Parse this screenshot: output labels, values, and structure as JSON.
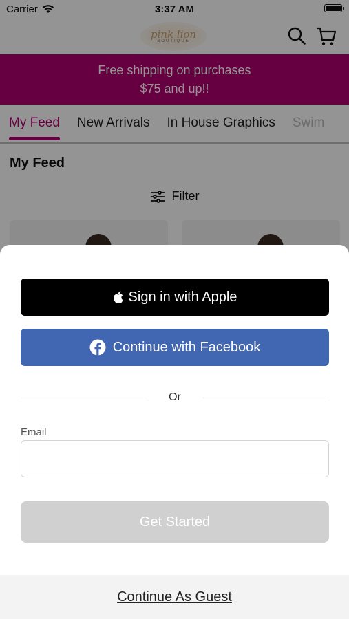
{
  "status_bar": {
    "carrier": "Carrier",
    "time": "3:37 AM"
  },
  "header": {
    "logo_text": "pink lion",
    "logo_subtext": "BOUTIQUE"
  },
  "promo": {
    "line1": "Free shipping on purchases",
    "line2": "$75 and up!!",
    "color": "#b1006e"
  },
  "tabs": [
    {
      "label": "My Feed",
      "active": true
    },
    {
      "label": "New Arrivals",
      "active": false
    },
    {
      "label": "In House Graphics",
      "active": false
    },
    {
      "label": "Swim",
      "active": false
    }
  ],
  "feed": {
    "title": "My Feed",
    "filter_label": "Filter"
  },
  "auth_sheet": {
    "apple_label": "Sign in with Apple",
    "facebook_label": "Continue with Facebook",
    "facebook_color": "#4267b2",
    "divider_label": "Or",
    "email_label": "Email",
    "email_value": "",
    "email_placeholder": "",
    "get_started_label": "Get Started",
    "guest_label": "Continue As Guest"
  }
}
